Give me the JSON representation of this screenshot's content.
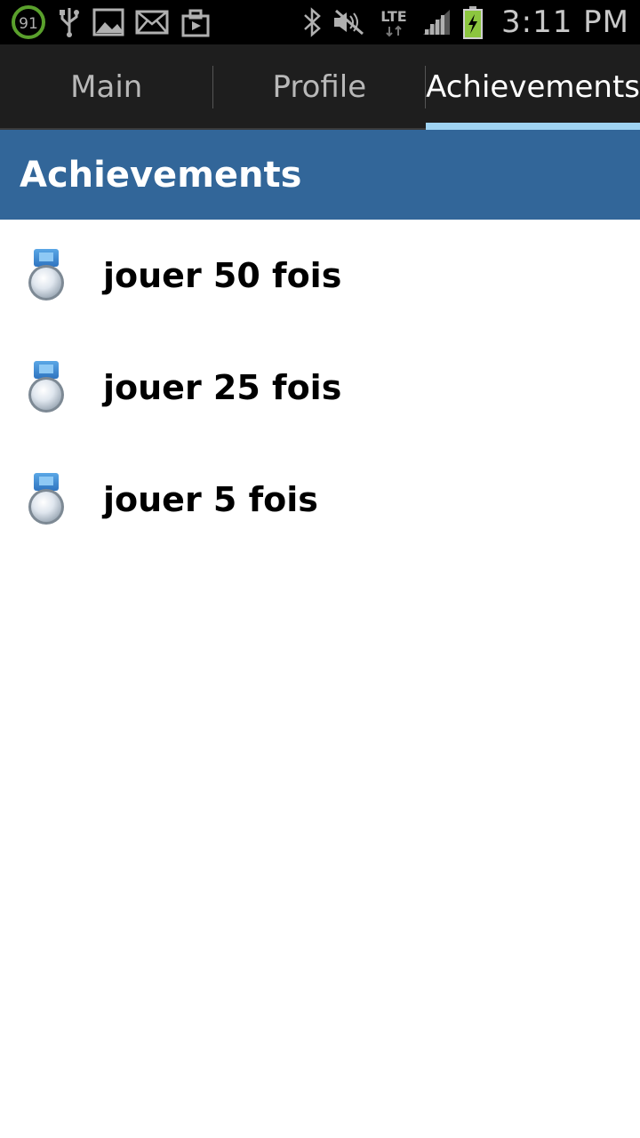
{
  "status_bar": {
    "notification_count": "91",
    "network": "LTE",
    "time": "3:11 PM",
    "icons": [
      "battery-91-badge-icon",
      "usb-icon",
      "image-icon",
      "email-icon",
      "briefcase-icon",
      "bluetooth-icon",
      "mute-icon",
      "lte-icon",
      "signal-icon",
      "battery-charging-icon"
    ]
  },
  "tabs": [
    {
      "label": "Main",
      "active": false
    },
    {
      "label": "Profile",
      "active": false
    },
    {
      "label": "Achievements",
      "active": true
    }
  ],
  "header": {
    "title": "Achievements"
  },
  "achievements": [
    {
      "label": "jouer 50 fois",
      "icon": "medal-icon"
    },
    {
      "label": "jouer 25 fois",
      "icon": "medal-icon"
    },
    {
      "label": "jouer 5 fois",
      "icon": "medal-icon"
    }
  ],
  "colors": {
    "accent": "#326699",
    "tab_indicator": "#9fd3f2",
    "tab_bar": "#1e1e1e",
    "battery": "#8cc63f",
    "notification_badge": "#5aa02c"
  }
}
